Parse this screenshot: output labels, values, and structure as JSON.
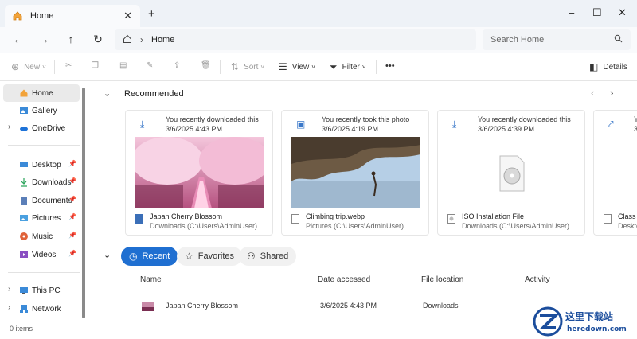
{
  "window": {
    "tab_title": "Home",
    "new_tab": "+",
    "minimize": "–",
    "maximize": "☐",
    "close": "✕"
  },
  "nav": {
    "breadcrumb": "Home",
    "search_placeholder": "Search Home"
  },
  "toolbar": {
    "new": "New",
    "sort": "Sort",
    "view": "View",
    "filter": "Filter",
    "more": "•••",
    "details": "Details"
  },
  "sidebar": {
    "items": [
      {
        "label": "Home",
        "icon": "home-icon",
        "selected": true
      },
      {
        "label": "Gallery",
        "icon": "gallery-icon"
      },
      {
        "label": "OneDrive",
        "icon": "cloud-icon"
      },
      {
        "label": "Desktop",
        "icon": "desktop-icon"
      },
      {
        "label": "Downloads",
        "icon": "download-icon"
      },
      {
        "label": "Documents",
        "icon": "documents-icon"
      },
      {
        "label": "Pictures",
        "icon": "pictures-icon"
      },
      {
        "label": "Music",
        "icon": "music-icon"
      },
      {
        "label": "Videos",
        "icon": "videos-icon"
      },
      {
        "label": "This PC",
        "icon": "pc-icon"
      },
      {
        "label": "Network",
        "icon": "network-icon"
      }
    ]
  },
  "recommended": {
    "title": "Recommended",
    "cards": [
      {
        "headline": "You recently downloaded this",
        "date": "3/6/2025 4:43 PM",
        "name": "Japan Cherry Blossom",
        "path": "Downloads (C:\\Users\\AdminUser)"
      },
      {
        "headline": "You recently took this photo",
        "date": "3/6/2025 4:19 PM",
        "name": "Climbing trip.webp",
        "path": "Pictures (C:\\Users\\AdminUser)"
      },
      {
        "headline": "You recently downloaded this",
        "date": "3/6/2025 4:39 PM",
        "name": "ISO Installation File",
        "path": "Downloads (C:\\Users\\AdminUser)"
      },
      {
        "headline": "Y",
        "date": "3",
        "name": "Class I",
        "path": "Deskto"
      }
    ]
  },
  "tabs": {
    "recent": "Recent",
    "favorites": "Favorites",
    "shared": "Shared"
  },
  "list": {
    "columns": [
      "Name",
      "Date accessed",
      "File location",
      "Activity"
    ],
    "rows": [
      {
        "name": "Japan Cherry Blossom",
        "date": "3/6/2025 4:43 PM",
        "location": "Downloads"
      }
    ]
  },
  "status": {
    "items": "0 items"
  },
  "watermark": {
    "cn": "这里下载站",
    "url": "heredown.com"
  },
  "colors": {
    "accent": "#1f6fd1"
  }
}
